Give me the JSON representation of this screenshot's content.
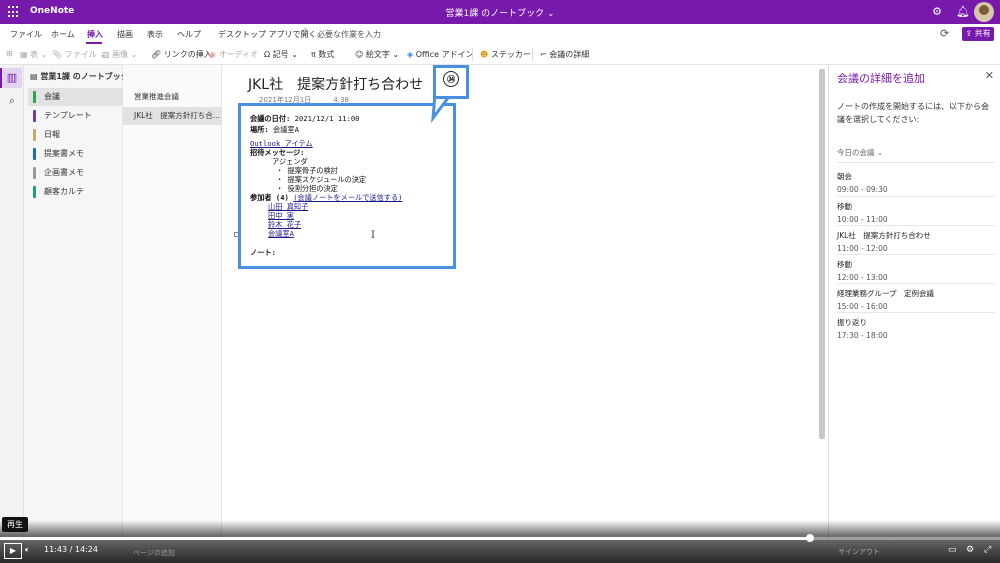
{
  "titlebar": {
    "app_name": "OneNote",
    "notebook_title": "営業1課 のノートブック ⌄",
    "settings_icon": "gear-icon",
    "bell_icon": "bell-icon"
  },
  "menu": {
    "items": [
      "ファイル",
      "ホーム",
      "挿入",
      "描画",
      "表示",
      "ヘルプ",
      "デスクトップ アプリで開く"
    ],
    "active": "挿入",
    "search_placeholder": "必要な作業を入力",
    "share_label": "共有"
  },
  "ribbon": {
    "items": [
      "表 ⌄",
      "ファイル ⌄",
      "画像 ⌄",
      "リンクの挿入",
      "オーディオ",
      "記号 ⌄",
      "数式",
      "絵文字 ⌄",
      "Office アドイン",
      "ステッカー",
      "会議の詳細"
    ]
  },
  "notebook": {
    "name": "営業1課 のノートブック ⌄",
    "sections": [
      {
        "label": "会議",
        "color": "#2ea44f"
      },
      {
        "label": "テンプレート",
        "color": "#6b3fa0"
      },
      {
        "label": "日報",
        "color": "#c9a86b"
      },
      {
        "label": "提案書メモ",
        "color": "#1f6fb5"
      },
      {
        "label": "企画書メモ",
        "color": "#999999"
      },
      {
        "label": "顧客カルテ",
        "color": "#1aa37a"
      }
    ],
    "selected_section": "会議"
  },
  "pages": {
    "items": [
      "営業推進会議",
      "JKL社　提案方針打ち合..."
    ],
    "selected": "JKL社　提案方針打ち合..."
  },
  "page": {
    "title": "JKL社　提案方針打ち合わせ",
    "date": "2021年12月1日",
    "time": "4:38",
    "meeting_date_label": "会議の日付:",
    "meeting_date_value": "2021/12/1 11:00",
    "location_label": "場所:",
    "location_value": "会議室A",
    "outlook_link": "Outlook アイテム",
    "invite_label": "招待メッセージ:",
    "agenda_title": "アジェンダ",
    "agenda_items": [
      "・ 提案骨子の検討",
      "・ 提案スケジュールの決定",
      "・ 役割分担の決定"
    ],
    "attendees_label": "参加者 (4)",
    "send_link": "(会議ノートをメールで送信する)",
    "attendees": [
      "山田 真知子",
      "田中 実",
      "鈴木 花子",
      "会議室A"
    ],
    "notes_label": "ノート:"
  },
  "callout": {
    "number": "㉞"
  },
  "right_pane": {
    "title": "会議の詳細を追加",
    "description": "ノートの作成を開始するには、以下から会議を選択してください:",
    "day_filter": "今日の会議 ⌄",
    "meetings": [
      {
        "name": "朝会",
        "time": "09:00 - 09:30"
      },
      {
        "name": "移動",
        "time": "10:00 - 11:00"
      },
      {
        "name": "JKL社　提案方針打ち合わせ",
        "time": "11:00 - 12:00"
      },
      {
        "name": "移動",
        "time": "12:00 - 13:00"
      },
      {
        "name": "経理業務グループ　定例会議",
        "time": "15:00 - 16:00"
      },
      {
        "name": "振り返り",
        "time": "17:30 - 18:00"
      }
    ]
  },
  "video": {
    "tooltip": "再生",
    "current_time": "11:43",
    "separator": "/",
    "total_time": "14:24",
    "progress": 0.81,
    "ghost_add_page": "ページの追加",
    "ghost_signout": "サインアウト"
  }
}
